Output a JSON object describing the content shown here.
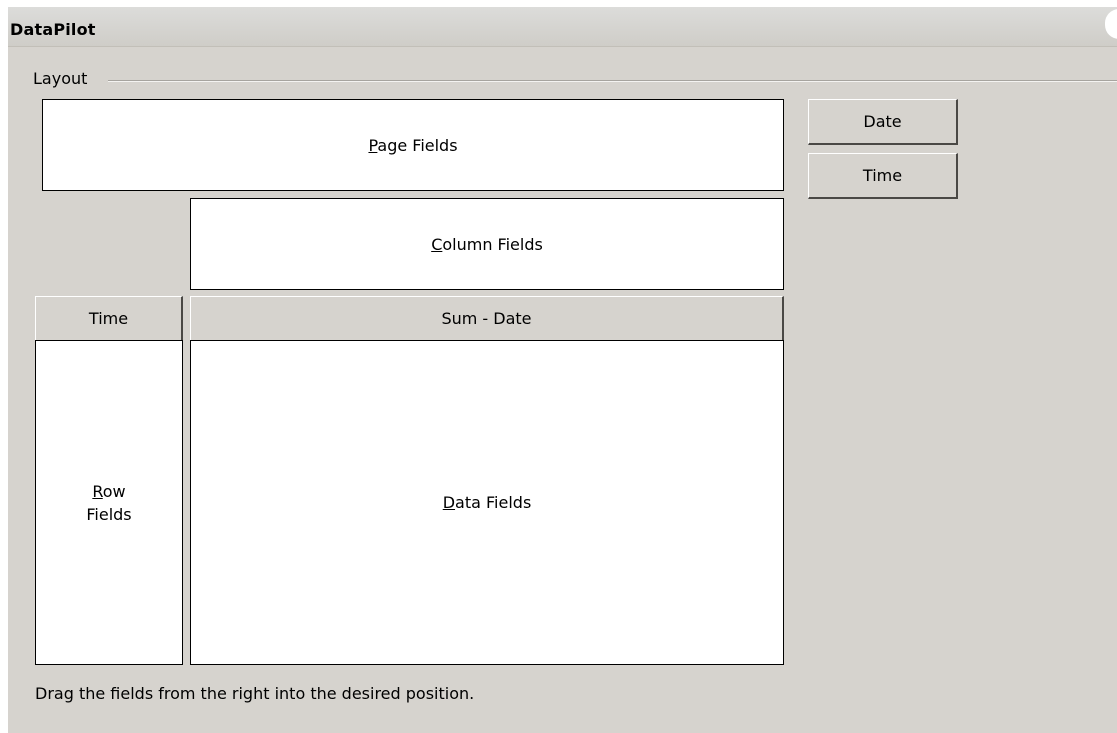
{
  "window": {
    "title": "DataPilot"
  },
  "layout": {
    "group_label": "Layout",
    "page_fields": {
      "mnemonic": "P",
      "rest": "age Fields"
    },
    "column_fields": {
      "mnemonic": "C",
      "rest": "olumn Fields"
    },
    "row_fields": {
      "mnemonic": "R",
      "rest_line1": "ow",
      "line2": "Fields"
    },
    "data_fields": {
      "mnemonic": "D",
      "rest": "ata Fields"
    },
    "row_field_buttons": [
      "Time"
    ],
    "data_field_buttons": [
      "Sum - Date"
    ],
    "available_fields": [
      "Date",
      "Time"
    ],
    "hint": "Drag the fields from the right into the desired position."
  }
}
